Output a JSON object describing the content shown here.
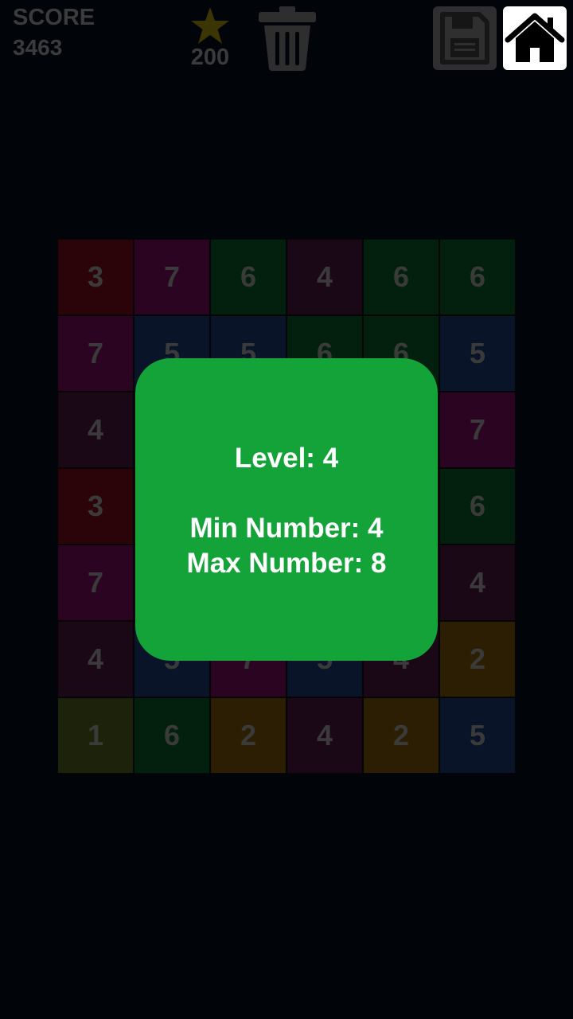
{
  "header": {
    "score_label": "SCORE",
    "score_value": "3463",
    "stars": "200"
  },
  "icons": {
    "star": "star-icon",
    "trash": "trash-icon",
    "save": "floppy-disk-icon",
    "home": "home-icon"
  },
  "board": {
    "rows": [
      [
        "3",
        "7",
        "6",
        "4",
        "6",
        "6"
      ],
      [
        "7",
        "5",
        "5",
        "6",
        "6",
        "5"
      ],
      [
        "4",
        "",
        "",
        "",
        "",
        "7"
      ],
      [
        "3",
        "",
        "",
        "",
        "",
        "6"
      ],
      [
        "7",
        "",
        "",
        "",
        "",
        "4"
      ],
      [
        "4",
        "5",
        "7",
        "5",
        "4",
        "2"
      ],
      [
        "1",
        "6",
        "2",
        "4",
        "2",
        "5"
      ]
    ],
    "colors": [
      [
        "c3",
        "c7",
        "c6",
        "c4",
        "c6",
        "c6"
      ],
      [
        "c7",
        "c5",
        "c5",
        "c6",
        "c6",
        "c5"
      ],
      [
        "c4",
        "c4",
        "c4",
        "c4",
        "c4",
        "c7"
      ],
      [
        "c3",
        "c3",
        "c3",
        "c3",
        "c3",
        "c6"
      ],
      [
        "c7",
        "c7",
        "c7",
        "c7",
        "c7",
        "c4"
      ],
      [
        "c4",
        "c5",
        "c7",
        "c5",
        "c4",
        "c2"
      ],
      [
        "c1",
        "c6",
        "c2",
        "c4",
        "c2",
        "c5"
      ]
    ]
  },
  "dialog": {
    "level": "Level: 4",
    "min": "Min Number: 4",
    "max": "Max Number: 8"
  },
  "colors": {
    "background": "#01050a",
    "dialog": "#14a339",
    "star": "#3b3405",
    "header_text": "#3b3b3b"
  }
}
